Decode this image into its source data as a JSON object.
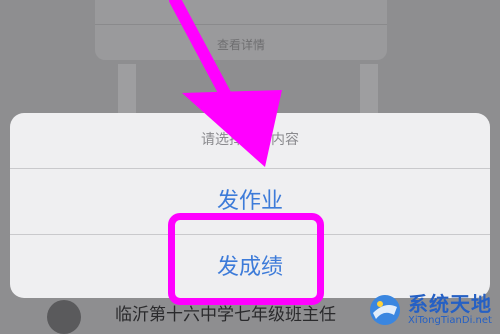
{
  "background": {
    "details_label": "查看详情",
    "bottom_text": "临沂第十六中学七年级班主任"
  },
  "action_sheet": {
    "title": "请选择发布内容",
    "options": [
      {
        "label": "发作业"
      },
      {
        "label": "发成绩"
      }
    ]
  },
  "annotation": {
    "arrow_color": "#ff00ff",
    "highlight_color": "#ff00ff"
  },
  "watermark": {
    "title": "系统天地",
    "url": "XiTongTianDi.net"
  },
  "colors": {
    "option_text": "#3d7bd9",
    "overlay": "#8e8e90",
    "brand": "#2560c4"
  }
}
